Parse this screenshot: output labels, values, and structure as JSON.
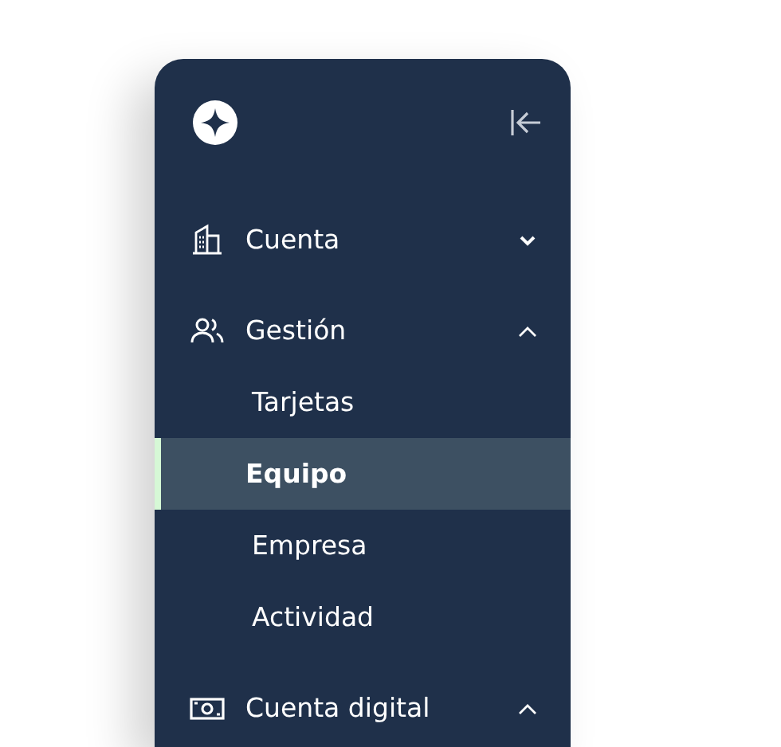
{
  "sections": [
    {
      "label": "Cuenta",
      "expanded": false
    },
    {
      "label": "Gestión",
      "expanded": true,
      "children": [
        {
          "label": "Tarjetas",
          "selected": false
        },
        {
          "label": "Equipo",
          "selected": true
        },
        {
          "label": "Empresa",
          "selected": false
        },
        {
          "label": "Actividad",
          "selected": false
        }
      ]
    },
    {
      "label": "Cuenta digital",
      "expanded": true
    }
  ]
}
